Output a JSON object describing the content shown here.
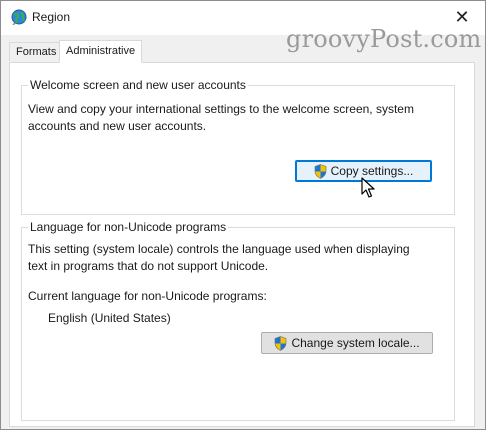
{
  "window": {
    "title": "Region",
    "close_label": "✕"
  },
  "watermark": "groovyPost.com",
  "tabs": [
    {
      "label": "Formats",
      "active": false
    },
    {
      "label": "Administrative",
      "active": true
    }
  ],
  "welcome_group": {
    "legend": "Welcome screen and new user accounts",
    "description_line1": "View and copy your international settings to the welcome screen, system",
    "description_line2": "accounts and new user accounts.",
    "copy_button": "Copy settings..."
  },
  "language_group": {
    "legend": "Language for non-Unicode programs",
    "description_line1": "This setting (system locale) controls the language used when displaying",
    "description_line2": "text in programs that do not support Unicode.",
    "current_label": "Current language for non-Unicode programs:",
    "current_value": "English (United States)",
    "change_button": "Change system locale..."
  },
  "icons": {
    "window_icon": "globe-icon",
    "button_icon": "uac-shield-icon"
  }
}
